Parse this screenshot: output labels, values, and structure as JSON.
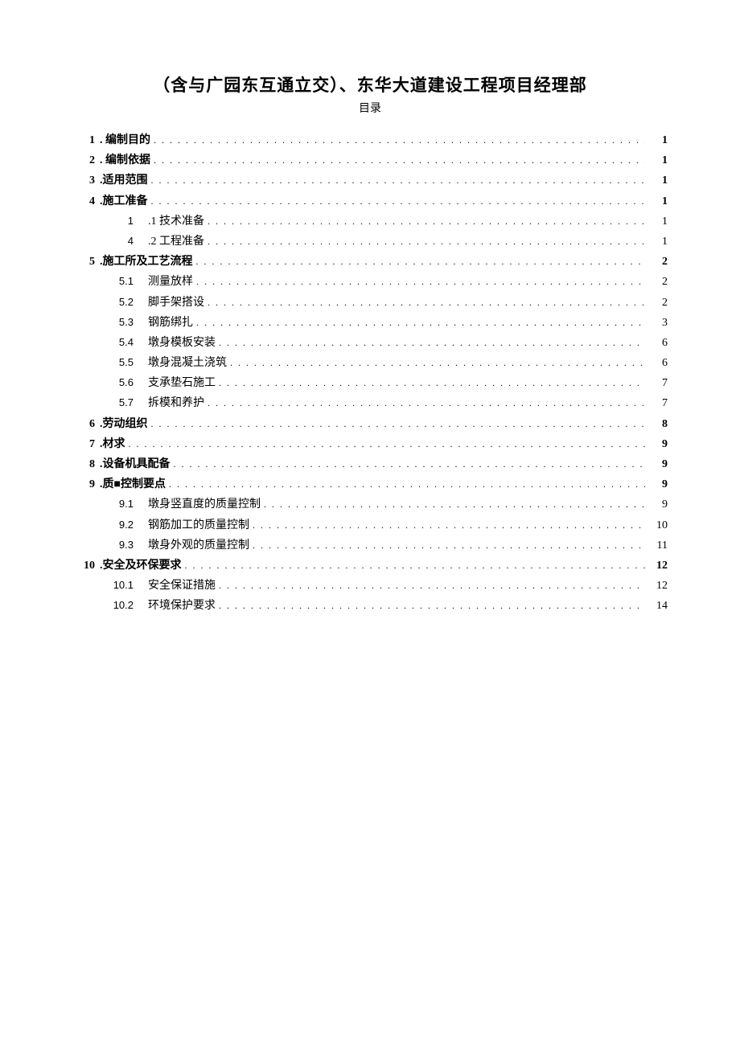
{
  "title": "（含与广园东互通立交）、东华大道建设工程项目经理部",
  "subtitle": "目录",
  "toc": [
    {
      "num": "1",
      "text": ". 编制目的",
      "page": "1",
      "level": 1,
      "bold": true
    },
    {
      "num": "2",
      "text": ". 编制依据",
      "page": "1",
      "level": 1,
      "bold": true
    },
    {
      "num": "3",
      "text": ".适用范围",
      "page": "1",
      "level": 1,
      "bold": true
    },
    {
      "num": "4",
      "text": ".施工准备",
      "page": "1",
      "level": 1,
      "bold": true
    },
    {
      "num": "1",
      "text": ".1 技术准备",
      "page": "1",
      "level": 2,
      "bold": false
    },
    {
      "num": "4",
      "text": ".2 工程准备",
      "page": "1",
      "level": 2,
      "bold": false
    },
    {
      "num": "5",
      "text": ".施工所及工艺流程",
      "page": "2",
      "level": 1,
      "bold": true
    },
    {
      "num": "5.1",
      "text": "测量放样",
      "page": "2",
      "level": 2,
      "bold": false
    },
    {
      "num": "5.2",
      "text": "脚手架搭设",
      "page": "2",
      "level": 2,
      "bold": false
    },
    {
      "num": "5.3",
      "text": "钢筋绑扎",
      "page": "3",
      "level": 2,
      "bold": false
    },
    {
      "num": "5.4",
      "text": "墩身模板安装",
      "page": "6",
      "level": 2,
      "bold": false
    },
    {
      "num": "5.5",
      "text": "墩身混凝土浇筑",
      "page": "6",
      "level": 2,
      "bold": false
    },
    {
      "num": "5.6",
      "text": "支承垫石施工",
      "page": "7",
      "level": 2,
      "bold": false
    },
    {
      "num": "5.7",
      "text": "拆模和养护",
      "page": "7",
      "level": 2,
      "bold": false
    },
    {
      "num": "6",
      "text": ".劳动组织",
      "page": "8",
      "level": 1,
      "bold": true
    },
    {
      "num": "7",
      "text": ".材求",
      "page": "9",
      "level": 1,
      "bold": true
    },
    {
      "num": "8",
      "text": ".设备机具配备",
      "page": "9",
      "level": 1,
      "bold": true
    },
    {
      "num": "9",
      "text": ".质■控制要点",
      "page": "9",
      "level": 1,
      "bold": true
    },
    {
      "num": "9.1",
      "text": "墩身竖直度的质量控制",
      "page": "9",
      "level": 2,
      "bold": false
    },
    {
      "num": "9.2",
      "text": "钢筋加工的质量控制",
      "page": "10",
      "level": 2,
      "bold": false
    },
    {
      "num": "9.3",
      "text": "墩身外观的质量控制",
      "page": "11",
      "level": 2,
      "bold": false
    },
    {
      "num": "10",
      "text": ".安全及环保要求",
      "page": "12",
      "level": 1,
      "bold": true
    },
    {
      "num": "10.1",
      "text": "安全保证措施",
      "page": "12",
      "level": 2,
      "bold": false
    },
    {
      "num": "10.2",
      "text": "环境保护要求",
      "page": "14",
      "level": 2,
      "bold": false
    }
  ]
}
